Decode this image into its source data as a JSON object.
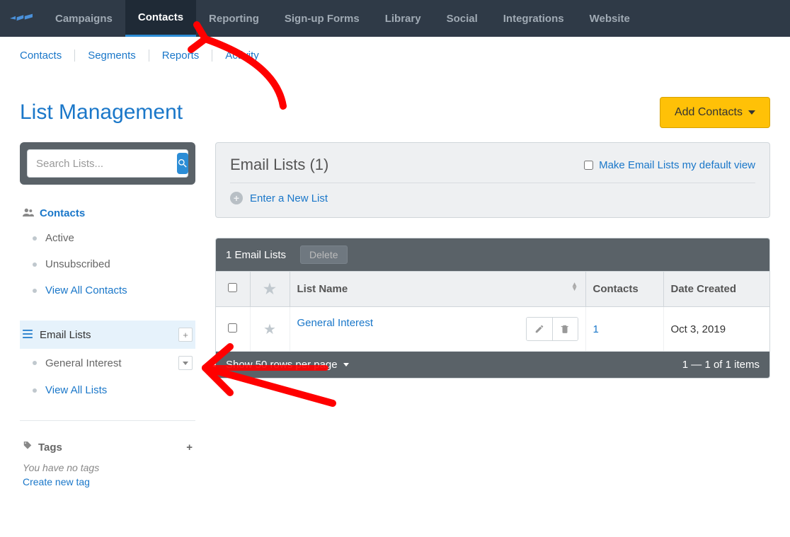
{
  "topnav": {
    "items": [
      "Campaigns",
      "Contacts",
      "Reporting",
      "Sign-up Forms",
      "Library",
      "Social",
      "Integrations",
      "Website"
    ],
    "active_index": 1
  },
  "subnav": {
    "items": [
      "Contacts",
      "Segments",
      "Reports",
      "Activity"
    ]
  },
  "page": {
    "title": "List Management",
    "add_button": "Add Contacts"
  },
  "search": {
    "placeholder": "Search Lists..."
  },
  "sidebar": {
    "contacts": {
      "heading": "Contacts",
      "items": [
        {
          "label": "Active",
          "type": "plain"
        },
        {
          "label": "Unsubscribed",
          "type": "plain"
        },
        {
          "label": "View All Contacts",
          "type": "link"
        }
      ]
    },
    "email_lists": {
      "heading": "Email Lists",
      "items": [
        {
          "label": "General Interest",
          "type": "dropdown"
        },
        {
          "label": "View All Lists",
          "type": "link"
        }
      ]
    },
    "tags": {
      "heading": "Tags",
      "empty_note": "You have no tags",
      "create_link": "Create new tag"
    }
  },
  "panel": {
    "title": "Email Lists (1)",
    "default_view_label": "Make Email Lists my default view",
    "enter_new": "Enter a New List"
  },
  "table": {
    "top_count": "1 Email Lists",
    "delete_label": "Delete",
    "columns": {
      "list_name": "List Name",
      "contacts": "Contacts",
      "date_created": "Date Created"
    },
    "rows": [
      {
        "name": "General Interest",
        "contacts": "1",
        "date": "Oct 3, 2019"
      }
    ],
    "footer": {
      "rows_per_page": "Show 50 rows per page",
      "pagination": "1 — 1 of 1 items"
    }
  }
}
